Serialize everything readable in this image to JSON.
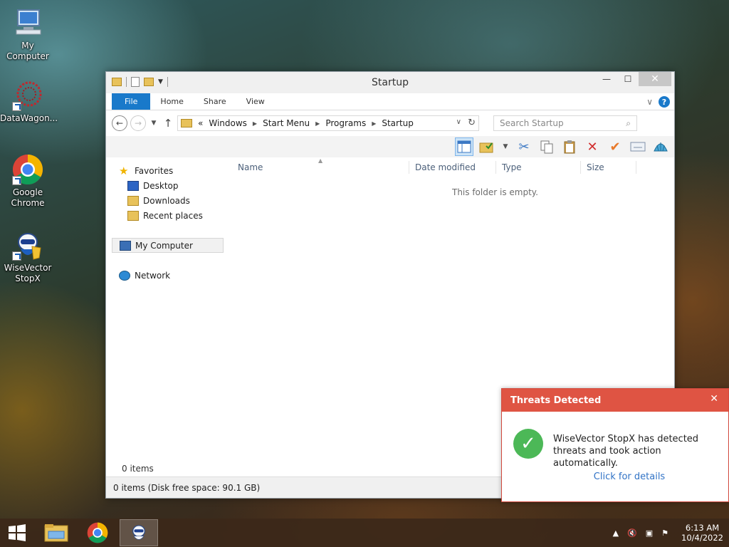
{
  "desktop": {
    "icons": [
      {
        "label": "My Computer"
      },
      {
        "label": "DataWagon..."
      },
      {
        "label": "Google Chrome"
      },
      {
        "label": "WiseVector StopX"
      }
    ]
  },
  "window": {
    "title": "Startup",
    "ribbon_tabs": [
      "File",
      "Home",
      "Share",
      "View"
    ],
    "breadcrumb_prefix": "«",
    "breadcrumb": [
      "Windows",
      "Start Menu",
      "Programs",
      "Startup"
    ],
    "search_placeholder": "Search Startup",
    "nav": {
      "favorites": "Favorites",
      "desktop": "Desktop",
      "downloads": "Downloads",
      "recent": "Recent places",
      "computer": "My Computer",
      "network": "Network"
    },
    "columns": [
      "Name",
      "Date modified",
      "Type",
      "Size"
    ],
    "empty_message": "This folder is empty.",
    "items_count": "0 items",
    "status": "0 items (Disk free space: 90.1 GB)"
  },
  "notification": {
    "title": "Threats Detected",
    "message": "WiseVector StopX has detected threats and took action automatically.",
    "link": "Click for details"
  },
  "taskbar": {
    "time": "6:13 AM",
    "date": "10/4/2022"
  },
  "colors": {
    "accent": "#1979ca",
    "alert_red": "#df5443",
    "success_green": "#4cb857"
  }
}
